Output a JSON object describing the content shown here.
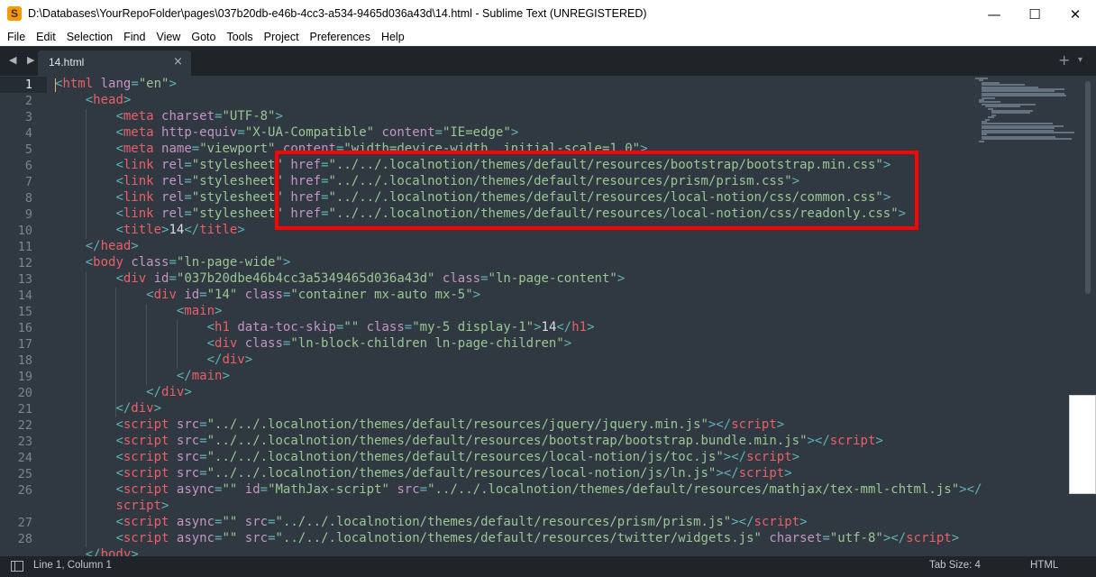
{
  "window": {
    "title": "D:\\Databases\\YourRepoFolder\\pages\\037b20db-e46b-4cc3-a534-9465d036a43d\\14.html - Sublime Text (UNREGISTERED)",
    "app_icon": "S",
    "minimize": "—",
    "maximize": "☐",
    "close": "✕"
  },
  "menu": [
    "File",
    "Edit",
    "Selection",
    "Find",
    "View",
    "Goto",
    "Tools",
    "Project",
    "Preferences",
    "Help"
  ],
  "tabs": {
    "nav": "◀ ▶",
    "active_label": "14.html",
    "close": "×",
    "plus": "+",
    "chevron": "▾"
  },
  "editor": {
    "line_numbers": [
      "1",
      "2",
      "3",
      "4",
      "5",
      "6",
      "7",
      "8",
      "9",
      "10",
      "11",
      "12",
      "13",
      "14",
      "15",
      "16",
      "17",
      "18",
      "19",
      "20",
      "21",
      "22",
      "23",
      "24",
      "25",
      "26",
      "",
      "27",
      "28"
    ],
    "lines": [
      [
        [
          "pun",
          "<"
        ],
        [
          "tag",
          "html"
        ],
        [
          "txt",
          " "
        ],
        [
          "attr",
          "lang"
        ],
        [
          "pun",
          "="
        ],
        [
          "str",
          "\"en\""
        ],
        [
          "pun",
          ">"
        ]
      ],
      [
        [
          "txt",
          "    "
        ],
        [
          "pun",
          "<"
        ],
        [
          "tag",
          "head"
        ],
        [
          "pun",
          ">"
        ]
      ],
      [
        [
          "txt",
          "        "
        ],
        [
          "pun",
          "<"
        ],
        [
          "tag",
          "meta"
        ],
        [
          "txt",
          " "
        ],
        [
          "attr",
          "charset"
        ],
        [
          "pun",
          "="
        ],
        [
          "str",
          "\"UTF-8\""
        ],
        [
          "pun",
          ">"
        ]
      ],
      [
        [
          "txt",
          "        "
        ],
        [
          "pun",
          "<"
        ],
        [
          "tag",
          "meta"
        ],
        [
          "txt",
          " "
        ],
        [
          "attr",
          "http-equiv"
        ],
        [
          "pun",
          "="
        ],
        [
          "str",
          "\"X-UA-Compatible\""
        ],
        [
          "txt",
          " "
        ],
        [
          "attr",
          "content"
        ],
        [
          "pun",
          "="
        ],
        [
          "str",
          "\"IE=edge\""
        ],
        [
          "pun",
          ">"
        ]
      ],
      [
        [
          "txt",
          "        "
        ],
        [
          "pun",
          "<"
        ],
        [
          "tag",
          "meta"
        ],
        [
          "txt",
          " "
        ],
        [
          "attr",
          "name"
        ],
        [
          "pun",
          "="
        ],
        [
          "str",
          "\"viewport\""
        ],
        [
          "txt",
          " "
        ],
        [
          "attr",
          "content"
        ],
        [
          "pun",
          "="
        ],
        [
          "str",
          "\"width=device-width, initial-scale=1.0\""
        ],
        [
          "pun",
          ">"
        ]
      ],
      [
        [
          "txt",
          "        "
        ],
        [
          "pun",
          "<"
        ],
        [
          "tag",
          "link"
        ],
        [
          "txt",
          " "
        ],
        [
          "attr",
          "rel"
        ],
        [
          "pun",
          "="
        ],
        [
          "str",
          "\"stylesheet\""
        ],
        [
          "txt",
          " "
        ],
        [
          "attr",
          "href"
        ],
        [
          "pun",
          "="
        ],
        [
          "str",
          "\"../../.localnotion/themes/default/resources/bootstrap/bootstrap.min.css\""
        ],
        [
          "pun",
          ">"
        ]
      ],
      [
        [
          "txt",
          "        "
        ],
        [
          "pun",
          "<"
        ],
        [
          "tag",
          "link"
        ],
        [
          "txt",
          " "
        ],
        [
          "attr",
          "rel"
        ],
        [
          "pun",
          "="
        ],
        [
          "str",
          "\"stylesheet\""
        ],
        [
          "txt",
          " "
        ],
        [
          "attr",
          "href"
        ],
        [
          "pun",
          "="
        ],
        [
          "str",
          "\"../../.localnotion/themes/default/resources/prism/prism.css\""
        ],
        [
          "pun",
          ">"
        ]
      ],
      [
        [
          "txt",
          "        "
        ],
        [
          "pun",
          "<"
        ],
        [
          "tag",
          "link"
        ],
        [
          "txt",
          " "
        ],
        [
          "attr",
          "rel"
        ],
        [
          "pun",
          "="
        ],
        [
          "str",
          "\"stylesheet\""
        ],
        [
          "txt",
          " "
        ],
        [
          "attr",
          "href"
        ],
        [
          "pun",
          "="
        ],
        [
          "str",
          "\"../../.localnotion/themes/default/resources/local-notion/css/common.css\""
        ],
        [
          "pun",
          ">"
        ]
      ],
      [
        [
          "txt",
          "        "
        ],
        [
          "pun",
          "<"
        ],
        [
          "tag",
          "link"
        ],
        [
          "txt",
          " "
        ],
        [
          "attr",
          "rel"
        ],
        [
          "pun",
          "="
        ],
        [
          "str",
          "\"stylesheet\""
        ],
        [
          "txt",
          " "
        ],
        [
          "attr",
          "href"
        ],
        [
          "pun",
          "="
        ],
        [
          "str",
          "\"../../.localnotion/themes/default/resources/local-notion/css/readonly.css\""
        ],
        [
          "pun",
          ">"
        ]
      ],
      [
        [
          "txt",
          "        "
        ],
        [
          "pun",
          "<"
        ],
        [
          "tag",
          "title"
        ],
        [
          "pun",
          ">"
        ],
        [
          "txt",
          "14"
        ],
        [
          "pun",
          "</"
        ],
        [
          "tag",
          "title"
        ],
        [
          "pun",
          ">"
        ]
      ],
      [
        [
          "txt",
          "    "
        ],
        [
          "pun",
          "</"
        ],
        [
          "tag",
          "head"
        ],
        [
          "pun",
          ">"
        ]
      ],
      [
        [
          "txt",
          "    "
        ],
        [
          "pun",
          "<"
        ],
        [
          "tag",
          "body"
        ],
        [
          "txt",
          " "
        ],
        [
          "attr",
          "class"
        ],
        [
          "pun",
          "="
        ],
        [
          "str",
          "\"ln-page-wide\""
        ],
        [
          "pun",
          ">"
        ]
      ],
      [
        [
          "txt",
          "        "
        ],
        [
          "pun",
          "<"
        ],
        [
          "tag",
          "div"
        ],
        [
          "txt",
          " "
        ],
        [
          "attr",
          "id"
        ],
        [
          "pun",
          "="
        ],
        [
          "str",
          "\"037b20dbe46b4cc3a5349465d036a43d\""
        ],
        [
          "txt",
          " "
        ],
        [
          "attr",
          "class"
        ],
        [
          "pun",
          "="
        ],
        [
          "str",
          "\"ln-page-content\""
        ],
        [
          "pun",
          ">"
        ]
      ],
      [
        [
          "txt",
          "            "
        ],
        [
          "pun",
          "<"
        ],
        [
          "tag",
          "div"
        ],
        [
          "txt",
          " "
        ],
        [
          "attr",
          "id"
        ],
        [
          "pun",
          "="
        ],
        [
          "str",
          "\"14\""
        ],
        [
          "txt",
          " "
        ],
        [
          "attr",
          "class"
        ],
        [
          "pun",
          "="
        ],
        [
          "str",
          "\"container mx-auto mx-5\""
        ],
        [
          "pun",
          ">"
        ]
      ],
      [
        [
          "txt",
          "                "
        ],
        [
          "pun",
          "<"
        ],
        [
          "tag",
          "main"
        ],
        [
          "pun",
          ">"
        ]
      ],
      [
        [
          "txt",
          "                    "
        ],
        [
          "pun",
          "<"
        ],
        [
          "tag",
          "h1"
        ],
        [
          "txt",
          " "
        ],
        [
          "attr",
          "data-toc-skip"
        ],
        [
          "pun",
          "="
        ],
        [
          "str",
          "\"\""
        ],
        [
          "txt",
          " "
        ],
        [
          "attr",
          "class"
        ],
        [
          "pun",
          "="
        ],
        [
          "str",
          "\"my-5 display-1\""
        ],
        [
          "pun",
          ">"
        ],
        [
          "txt",
          "14"
        ],
        [
          "pun",
          "</"
        ],
        [
          "tag",
          "h1"
        ],
        [
          "pun",
          ">"
        ]
      ],
      [
        [
          "txt",
          "                    "
        ],
        [
          "pun",
          "<"
        ],
        [
          "tag",
          "div"
        ],
        [
          "txt",
          " "
        ],
        [
          "attr",
          "class"
        ],
        [
          "pun",
          "="
        ],
        [
          "str",
          "\"ln-block-children ln-page-children\""
        ],
        [
          "pun",
          ">"
        ]
      ],
      [
        [
          "txt",
          "                    "
        ],
        [
          "pun",
          "</"
        ],
        [
          "tag",
          "div"
        ],
        [
          "pun",
          ">"
        ]
      ],
      [
        [
          "txt",
          "                "
        ],
        [
          "pun",
          "</"
        ],
        [
          "tag",
          "main"
        ],
        [
          "pun",
          ">"
        ]
      ],
      [
        [
          "txt",
          "            "
        ],
        [
          "pun",
          "</"
        ],
        [
          "tag",
          "div"
        ],
        [
          "pun",
          ">"
        ]
      ],
      [
        [
          "txt",
          "        "
        ],
        [
          "pun",
          "</"
        ],
        [
          "tag",
          "div"
        ],
        [
          "pun",
          ">"
        ]
      ],
      [
        [
          "txt",
          "        "
        ],
        [
          "pun",
          "<"
        ],
        [
          "tag",
          "script"
        ],
        [
          "txt",
          " "
        ],
        [
          "attr",
          "src"
        ],
        [
          "pun",
          "="
        ],
        [
          "str",
          "\"../../.localnotion/themes/default/resources/jquery/jquery.min.js\""
        ],
        [
          "pun",
          "></"
        ],
        [
          "tag",
          "script"
        ],
        [
          "pun",
          ">"
        ]
      ],
      [
        [
          "txt",
          "        "
        ],
        [
          "pun",
          "<"
        ],
        [
          "tag",
          "script"
        ],
        [
          "txt",
          " "
        ],
        [
          "attr",
          "src"
        ],
        [
          "pun",
          "="
        ],
        [
          "str",
          "\"../../.localnotion/themes/default/resources/bootstrap/bootstrap.bundle.min.js\""
        ],
        [
          "pun",
          "></"
        ],
        [
          "tag",
          "script"
        ],
        [
          "pun",
          ">"
        ]
      ],
      [
        [
          "txt",
          "        "
        ],
        [
          "pun",
          "<"
        ],
        [
          "tag",
          "script"
        ],
        [
          "txt",
          " "
        ],
        [
          "attr",
          "src"
        ],
        [
          "pun",
          "="
        ],
        [
          "str",
          "\"../../.localnotion/themes/default/resources/local-notion/js/toc.js\""
        ],
        [
          "pun",
          "></"
        ],
        [
          "tag",
          "script"
        ],
        [
          "pun",
          ">"
        ]
      ],
      [
        [
          "txt",
          "        "
        ],
        [
          "pun",
          "<"
        ],
        [
          "tag",
          "script"
        ],
        [
          "txt",
          " "
        ],
        [
          "attr",
          "src"
        ],
        [
          "pun",
          "="
        ],
        [
          "str",
          "\"../../.localnotion/themes/default/resources/local-notion/js/ln.js\""
        ],
        [
          "pun",
          "></"
        ],
        [
          "tag",
          "script"
        ],
        [
          "pun",
          ">"
        ]
      ],
      [
        [
          "txt",
          "        "
        ],
        [
          "pun",
          "<"
        ],
        [
          "tag",
          "script"
        ],
        [
          "txt",
          " "
        ],
        [
          "attr",
          "async"
        ],
        [
          "pun",
          "="
        ],
        [
          "str",
          "\"\""
        ],
        [
          "txt",
          " "
        ],
        [
          "attr",
          "id"
        ],
        [
          "pun",
          "="
        ],
        [
          "str",
          "\"MathJax-script\""
        ],
        [
          "txt",
          " "
        ],
        [
          "attr",
          "src"
        ],
        [
          "pun",
          "="
        ],
        [
          "str",
          "\"../../.localnotion/themes/default/resources/mathjax/tex-mml-chtml.js\""
        ],
        [
          "pun",
          "></"
        ]
      ],
      [
        [
          "txt",
          "        "
        ],
        [
          "tag",
          "script"
        ],
        [
          "pun",
          ">"
        ]
      ],
      [
        [
          "txt",
          "        "
        ],
        [
          "pun",
          "<"
        ],
        [
          "tag",
          "script"
        ],
        [
          "txt",
          " "
        ],
        [
          "attr",
          "async"
        ],
        [
          "pun",
          "="
        ],
        [
          "str",
          "\"\""
        ],
        [
          "txt",
          " "
        ],
        [
          "attr",
          "src"
        ],
        [
          "pun",
          "="
        ],
        [
          "str",
          "\"../../.localnotion/themes/default/resources/prism/prism.js\""
        ],
        [
          "pun",
          "></"
        ],
        [
          "tag",
          "script"
        ],
        [
          "pun",
          ">"
        ]
      ],
      [
        [
          "txt",
          "        "
        ],
        [
          "pun",
          "<"
        ],
        [
          "tag",
          "script"
        ],
        [
          "txt",
          " "
        ],
        [
          "attr",
          "async"
        ],
        [
          "pun",
          "="
        ],
        [
          "str",
          "\"\""
        ],
        [
          "txt",
          " "
        ],
        [
          "attr",
          "src"
        ],
        [
          "pun",
          "="
        ],
        [
          "str",
          "\"../../.localnotion/themes/default/resources/twitter/widgets.js\""
        ],
        [
          "txt",
          " "
        ],
        [
          "attr",
          "charset"
        ],
        [
          "pun",
          "="
        ],
        [
          "str",
          "\"utf-8\""
        ],
        [
          "pun",
          "></"
        ],
        [
          "tag",
          "script"
        ],
        [
          "pun",
          ">"
        ]
      ],
      [
        [
          "txt",
          "    "
        ],
        [
          "pun",
          "</"
        ],
        [
          "tag",
          "body"
        ],
        [
          "pun",
          ">"
        ]
      ]
    ]
  },
  "status": {
    "position": "Line 1, Column 1",
    "tab_size": "Tab Size: 4",
    "syntax": "HTML"
  },
  "colors": {
    "background": "#303841",
    "tag": "#ec5f67",
    "attribute": "#c594c5",
    "string": "#99c794",
    "punctuation": "#5fb3b3",
    "highlight": "#ff0000"
  }
}
